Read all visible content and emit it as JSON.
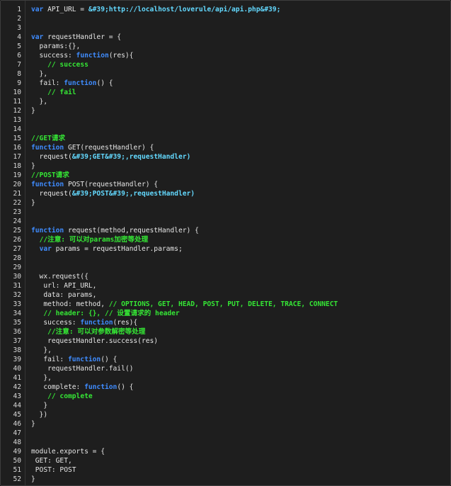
{
  "editor": {
    "lines": [
      {
        "n": "1",
        "tokens": [
          {
            "t": "var",
            "c": "keyword"
          },
          {
            "t": " API_URL = ",
            "c": "plain"
          },
          {
            "t": "&#39;http://localhost/loverule/api/api.php&#39;",
            "c": "string"
          }
        ]
      },
      {
        "n": "2",
        "tokens": []
      },
      {
        "n": "3",
        "tokens": []
      },
      {
        "n": "4",
        "tokens": [
          {
            "t": "var",
            "c": "keyword"
          },
          {
            "t": " requestHandler = {",
            "c": "plain"
          }
        ]
      },
      {
        "n": "5",
        "tokens": [
          {
            "t": "  params:{},",
            "c": "plain"
          }
        ]
      },
      {
        "n": "6",
        "tokens": [
          {
            "t": "  success: ",
            "c": "plain"
          },
          {
            "t": "function",
            "c": "keyword"
          },
          {
            "t": "(res){",
            "c": "plain"
          }
        ]
      },
      {
        "n": "7",
        "tokens": [
          {
            "t": "    ",
            "c": "plain"
          },
          {
            "t": "// success",
            "c": "comment"
          }
        ]
      },
      {
        "n": "8",
        "tokens": [
          {
            "t": "  },",
            "c": "plain"
          }
        ]
      },
      {
        "n": "9",
        "tokens": [
          {
            "t": "  fail: ",
            "c": "plain"
          },
          {
            "t": "function",
            "c": "keyword"
          },
          {
            "t": "() {",
            "c": "plain"
          }
        ]
      },
      {
        "n": "10",
        "tokens": [
          {
            "t": "    ",
            "c": "plain"
          },
          {
            "t": "// fail",
            "c": "comment"
          }
        ]
      },
      {
        "n": "11",
        "tokens": [
          {
            "t": "  },",
            "c": "plain"
          }
        ]
      },
      {
        "n": "12",
        "tokens": [
          {
            "t": "}",
            "c": "plain"
          }
        ]
      },
      {
        "n": "13",
        "tokens": []
      },
      {
        "n": "14",
        "tokens": []
      },
      {
        "n": "15",
        "tokens": [
          {
            "t": "//GET请求",
            "c": "comment"
          }
        ]
      },
      {
        "n": "16",
        "tokens": [
          {
            "t": "function",
            "c": "keyword"
          },
          {
            "t": " GET(requestHandler) {",
            "c": "plain"
          }
        ]
      },
      {
        "n": "17",
        "tokens": [
          {
            "t": "  request(",
            "c": "plain"
          },
          {
            "t": "&#39;GET&#39;,requestHandler)",
            "c": "string"
          }
        ]
      },
      {
        "n": "18",
        "tokens": [
          {
            "t": "}",
            "c": "plain"
          }
        ]
      },
      {
        "n": "19",
        "tokens": [
          {
            "t": "//POST请求",
            "c": "comment"
          }
        ]
      },
      {
        "n": "20",
        "tokens": [
          {
            "t": "function",
            "c": "keyword"
          },
          {
            "t": " POST(requestHandler) {",
            "c": "plain"
          }
        ]
      },
      {
        "n": "21",
        "tokens": [
          {
            "t": "  request(",
            "c": "plain"
          },
          {
            "t": "&#39;POST&#39;,requestHandler)",
            "c": "string"
          }
        ]
      },
      {
        "n": "22",
        "tokens": [
          {
            "t": "}",
            "c": "plain"
          }
        ]
      },
      {
        "n": "23",
        "tokens": []
      },
      {
        "n": "24",
        "tokens": []
      },
      {
        "n": "25",
        "tokens": [
          {
            "t": "function",
            "c": "keyword"
          },
          {
            "t": " request(method,requestHandler) {",
            "c": "plain"
          }
        ]
      },
      {
        "n": "26",
        "tokens": [
          {
            "t": "  ",
            "c": "plain"
          },
          {
            "t": "//注意: 可以对params加密等处理",
            "c": "comment"
          }
        ]
      },
      {
        "n": "27",
        "tokens": [
          {
            "t": "  ",
            "c": "plain"
          },
          {
            "t": "var",
            "c": "keyword"
          },
          {
            "t": " params = requestHandler.params;",
            "c": "plain"
          }
        ]
      },
      {
        "n": "28",
        "tokens": []
      },
      {
        "n": "29",
        "tokens": []
      },
      {
        "n": "30",
        "tokens": [
          {
            "t": "  wx.request({",
            "c": "plain"
          }
        ]
      },
      {
        "n": "31",
        "tokens": [
          {
            "t": "   url: API_URL,",
            "c": "plain"
          }
        ]
      },
      {
        "n": "32",
        "tokens": [
          {
            "t": "   data: params,",
            "c": "plain"
          }
        ]
      },
      {
        "n": "33",
        "tokens": [
          {
            "t": "   method: method, ",
            "c": "plain"
          },
          {
            "t": "// OPTIONS, GET, HEAD, POST, PUT, DELETE, TRACE, CONNECT",
            "c": "comment"
          }
        ]
      },
      {
        "n": "34",
        "tokens": [
          {
            "t": "   ",
            "c": "plain"
          },
          {
            "t": "// header: {}, // 设置请求的 header",
            "c": "comment"
          }
        ]
      },
      {
        "n": "35",
        "tokens": [
          {
            "t": "   success: ",
            "c": "plain"
          },
          {
            "t": "function",
            "c": "keyword"
          },
          {
            "t": "(res){",
            "c": "plain"
          }
        ]
      },
      {
        "n": "36",
        "tokens": [
          {
            "t": "    ",
            "c": "plain"
          },
          {
            "t": "//注意: 可以对参数解密等处理",
            "c": "comment"
          }
        ]
      },
      {
        "n": "37",
        "tokens": [
          {
            "t": "    requestHandler.success(res)",
            "c": "plain"
          }
        ]
      },
      {
        "n": "38",
        "tokens": [
          {
            "t": "   },",
            "c": "plain"
          }
        ]
      },
      {
        "n": "39",
        "tokens": [
          {
            "t": "   fail: ",
            "c": "plain"
          },
          {
            "t": "function",
            "c": "keyword"
          },
          {
            "t": "() {",
            "c": "plain"
          }
        ]
      },
      {
        "n": "40",
        "tokens": [
          {
            "t": "    requestHandler.fail()",
            "c": "plain"
          }
        ]
      },
      {
        "n": "41",
        "tokens": [
          {
            "t": "   },",
            "c": "plain"
          }
        ]
      },
      {
        "n": "42",
        "tokens": [
          {
            "t": "   complete: ",
            "c": "plain"
          },
          {
            "t": "function",
            "c": "keyword"
          },
          {
            "t": "() {",
            "c": "plain"
          }
        ]
      },
      {
        "n": "43",
        "tokens": [
          {
            "t": "    ",
            "c": "plain"
          },
          {
            "t": "// complete",
            "c": "comment"
          }
        ]
      },
      {
        "n": "44",
        "tokens": [
          {
            "t": "   }",
            "c": "plain"
          }
        ]
      },
      {
        "n": "45",
        "tokens": [
          {
            "t": "  })",
            "c": "plain"
          }
        ]
      },
      {
        "n": "46",
        "tokens": [
          {
            "t": "}",
            "c": "plain"
          }
        ]
      },
      {
        "n": "47",
        "tokens": []
      },
      {
        "n": "48",
        "tokens": []
      },
      {
        "n": "49",
        "tokens": [
          {
            "t": "module.exports = {",
            "c": "plain"
          }
        ]
      },
      {
        "n": "50",
        "tokens": [
          {
            "t": " GET: GET,",
            "c": "plain"
          }
        ]
      },
      {
        "n": "51",
        "tokens": [
          {
            "t": " POST: POST",
            "c": "plain"
          }
        ]
      },
      {
        "n": "52",
        "tokens": [
          {
            "t": "}",
            "c": "plain"
          }
        ]
      }
    ]
  },
  "colors": {
    "background": "#1e1e1e",
    "keyword": "#3f8cff",
    "comment": "#35e635",
    "string": "#63d9ff",
    "plain": "#e6e6e6",
    "line_number": "#d8d8d8"
  }
}
